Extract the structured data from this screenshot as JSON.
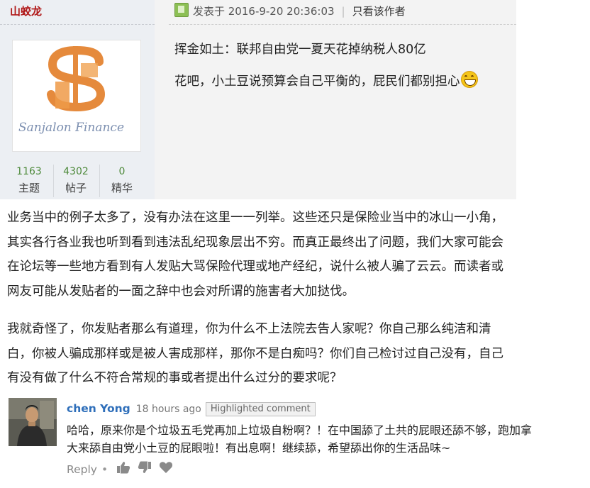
{
  "forum": {
    "username": "山蛟龙",
    "avatar_text": "Sanjalon Finance",
    "stats": [
      {
        "num": "1163",
        "label": "主题"
      },
      {
        "num": "4302",
        "label": "帖子"
      },
      {
        "num": "0",
        "label": "精华"
      }
    ],
    "post_time": "发表于 2016-9-20 20:36:03",
    "only_author": "只看该作者",
    "post_lines": [
      "挥金如土：联邦自由党一夏天花掉纳税人80亿",
      "花吧，小土豆说预算会自己平衡的，屁民们都别担心"
    ],
    "colors": {
      "username": "#b01717",
      "stat_num": "#4e8a3b"
    }
  },
  "article": {
    "paragraph1": [
      "业务当中的例子太多了，没有办法在这里一一列举。这些还只是保险业当中的冰山一小角，",
      "其实各行各业我也听到看到违法乱纪现象层出不穷。而真正最终出了问题，我们大家可能会",
      "在论坛等一些地方看到有人发贴大骂保险代理或地产经纪，说什么被人骗了云云。而读者或",
      "网友可能从发贴者的一面之辞中也会对所谓的施害者大加挞伐。"
    ],
    "paragraph2": [
      "我就奇怪了，你发贴者那么有道理，你为什么不上法院去告人家呢？你自己那么纯洁和清",
      "白，你被人骗成那样或是被人害成那样，那你不是白痴吗？你们自己检讨过自己没有，自己",
      "有没有做了什么不符合常规的事或者提出什么过分的要求呢？"
    ]
  },
  "comment": {
    "author": "chen Yong",
    "time": "18 hours ago",
    "badge": "Highlighted comment",
    "lines": [
      "哈哈，原来你是个垃圾五毛党再加上垃圾自粉啊？！在中国舔了土共的屁眼还舔不够，跑加拿",
      "大来舔自由党小土豆的屁眼啦！有出息啊！继续舔，希望舔出你的生活品味~"
    ],
    "reply_label": "Reply",
    "dot": "•",
    "icons": [
      "thumbs-up-icon",
      "thumbs-down-icon",
      "heart-icon"
    ],
    "colors": {
      "author": "#2f6fba"
    }
  }
}
